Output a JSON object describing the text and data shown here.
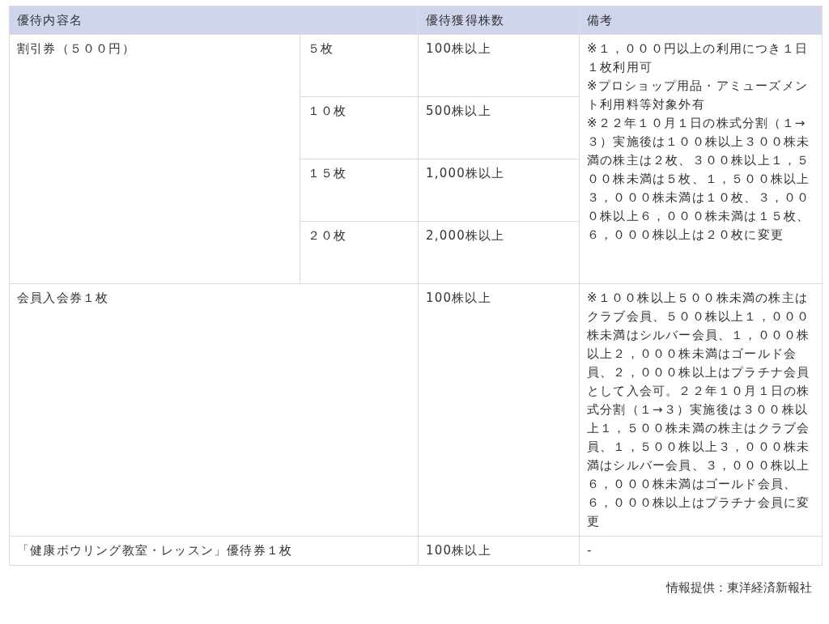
{
  "table": {
    "columns": [
      {
        "label": "優待内容名"
      },
      {
        "label": "優待獲得株数"
      },
      {
        "label": "備考"
      }
    ],
    "rows": [
      {
        "kind": "tiered",
        "name": "割引券（５００円）",
        "tiers": [
          {
            "quantity": "５枚",
            "shares": "100株以上"
          },
          {
            "quantity": "１０枚",
            "shares": "500株以上"
          },
          {
            "quantity": "１５枚",
            "shares": "1,000株以上"
          },
          {
            "quantity": "２０枚",
            "shares": "2,000株以上"
          }
        ],
        "notes": [
          "※１，０００円以上の利用につき１日１枚利用可",
          "※プロショップ用品・アミューズメント利用料等対象外有",
          "※２２年１０月１日の株式分割（１→３）実施後は１００株以上３００株未満の株主は２枚、３００株以上１，５００株未満は５枚、１，５００株以上３，０００株未満は１０枚、３，０００株以上６，０００株未満は１５枚、６，０００株以上は２０枚に変更"
        ]
      },
      {
        "kind": "single",
        "name": "会員入会券１枚",
        "shares": "100株以上",
        "notes": [
          "※１００株以上５００株未満の株主はクラブ会員、５００株以上１，０００株未満はシルバー会員、１，０００株以上２，０００株未満はゴールド会員、２，０００株以上はプラチナ会員として入会可。２２年１０月１日の株式分割（１→３）実施後は３００株以上１，５００株未満の株主はクラブ会員、１，５００株以上３，０００株未満はシルバー会員、３，０００株以上６，０００株未満はゴールド会員、６，０００株以上はプラチナ会員に変更"
        ]
      },
      {
        "kind": "single",
        "name": "「健康ボウリング教室・レッスン」優待券１枚",
        "shares": "100株以上",
        "notes": [
          "-"
        ]
      }
    ]
  },
  "source": "情報提供：東洋経済新報社"
}
